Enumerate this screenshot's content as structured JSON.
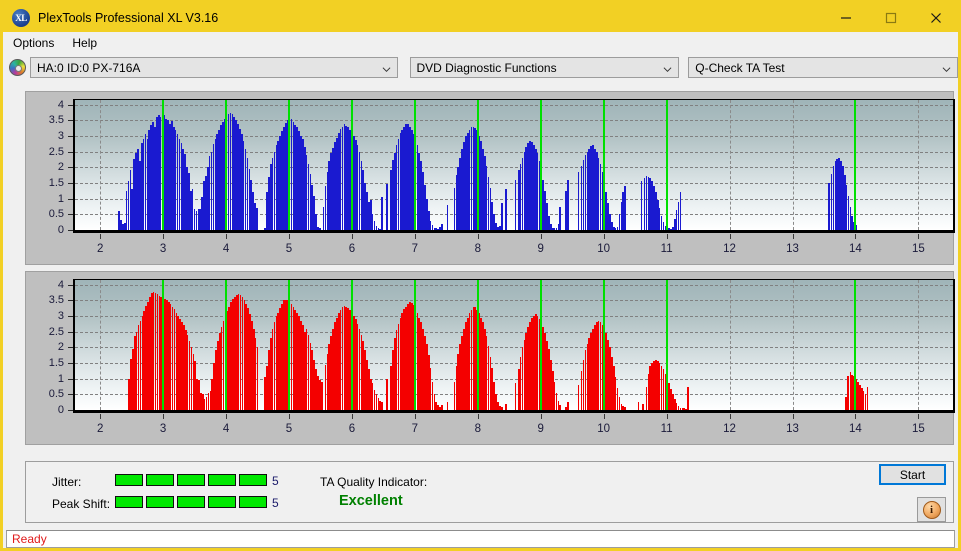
{
  "window": {
    "title": "PlexTools Professional XL V3.16",
    "app_icon": "xl-logo-icon",
    "minimize_label": "Minimize",
    "maximize_label": "Maximize",
    "close_label": "Close"
  },
  "menubar": {
    "items": [
      {
        "label": "Options"
      },
      {
        "label": "Help"
      }
    ]
  },
  "toolbar": {
    "drive_icon": "disc-icon",
    "drive_select": {
      "value": "HA:0 ID:0  PX-716A"
    },
    "function_select": {
      "value": "DVD Diagnostic Functions"
    },
    "test_select": {
      "value": "Q-Check TA Test"
    }
  },
  "results": {
    "jitter_label": "Jitter:",
    "jitter_value": "5",
    "jitter_segments": 5,
    "peak_shift_label": "Peak Shift:",
    "peak_shift_value": "5",
    "peak_shift_segments": 5,
    "ta_quality_label": "TA Quality Indicator:",
    "ta_quality_value": "Excellent",
    "ta_quality_color": "#008000",
    "start_label": "Start",
    "info_icon": "info-icon"
  },
  "statusbar": {
    "text": "Ready"
  },
  "colors": {
    "titlebar": "#f2d024",
    "window_border": "#f2d024",
    "blue_series": "#1a1ad0",
    "red_series": "#f40000",
    "marker_line": "#00e000",
    "status_text": "#e01b1b"
  },
  "chart_data": [
    {
      "type": "bar",
      "name": "jitter-chart",
      "series_color": "#1a1ad0",
      "title": "",
      "xlabel": "",
      "ylabel": "",
      "xlim": [
        1.6,
        15.55
      ],
      "ylim": [
        0,
        4.15
      ],
      "grid": true,
      "legend": "none",
      "yticks": [
        0,
        0.5,
        1,
        1.5,
        2,
        2.5,
        3,
        3.5,
        4
      ],
      "ytick_labels": [
        "0",
        "0.5",
        "1",
        "1.5",
        "2",
        "2.5",
        "3",
        "3.5",
        "4"
      ],
      "xticks": [
        2,
        3,
        4,
        5,
        6,
        7,
        8,
        9,
        10,
        11,
        12,
        13,
        14,
        15
      ],
      "xtick_labels": [
        "2",
        "3",
        "4",
        "5",
        "6",
        "7",
        "8",
        "9",
        "10",
        "11",
        "12",
        "13",
        "14",
        "15"
      ],
      "marker_lines": [
        3,
        4,
        5,
        6,
        7,
        8,
        9,
        10,
        11,
        14
      ],
      "bar_width": 0.022,
      "x": [
        2.3,
        2.33,
        2.36,
        2.39,
        2.42,
        2.45,
        2.48,
        2.51,
        2.54,
        2.57,
        2.6,
        2.63,
        2.66,
        2.69,
        2.72,
        2.75,
        2.78,
        2.81,
        2.84,
        2.87,
        2.9,
        2.93,
        2.96,
        2.99,
        3.02,
        3.05,
        3.08,
        3.11,
        3.14,
        3.17,
        3.2,
        3.23,
        3.26,
        3.29,
        3.32,
        3.35,
        3.38,
        3.41,
        3.44,
        3.47,
        3.5,
        3.53,
        3.56,
        3.59,
        3.62,
        3.65,
        3.68,
        3.71,
        3.74,
        3.77,
        3.8,
        3.83,
        3.86,
        3.89,
        3.92,
        3.95,
        3.98,
        4.01,
        4.04,
        4.07,
        4.1,
        4.13,
        4.16,
        4.19,
        4.22,
        4.25,
        4.28,
        4.31,
        4.34,
        4.37,
        4.4,
        4.43,
        4.46,
        4.49,
        4.62,
        4.65,
        4.68,
        4.71,
        4.74,
        4.77,
        4.8,
        4.83,
        4.86,
        4.89,
        4.92,
        4.95,
        4.98,
        5.01,
        5.04,
        5.07,
        5.1,
        5.13,
        5.16,
        5.19,
        5.22,
        5.25,
        5.28,
        5.31,
        5.34,
        5.37,
        5.4,
        5.43,
        5.46,
        5.49,
        5.55,
        5.58,
        5.61,
        5.64,
        5.67,
        5.7,
        5.73,
        5.76,
        5.79,
        5.82,
        5.85,
        5.88,
        5.91,
        5.94,
        5.97,
        6.0,
        6.03,
        6.06,
        6.09,
        6.12,
        6.15,
        6.18,
        6.21,
        6.24,
        6.27,
        6.3,
        6.33,
        6.36,
        6.39,
        6.42,
        6.45,
        6.48,
        6.56,
        6.62,
        6.65,
        6.68,
        6.71,
        6.74,
        6.77,
        6.8,
        6.83,
        6.86,
        6.89,
        6.92,
        6.95,
        6.98,
        7.01,
        7.04,
        7.07,
        7.1,
        7.13,
        7.16,
        7.19,
        7.22,
        7.25,
        7.28,
        7.31,
        7.34,
        7.37,
        7.4,
        7.43,
        7.52,
        7.63,
        7.66,
        7.69,
        7.72,
        7.75,
        7.78,
        7.81,
        7.84,
        7.87,
        7.9,
        7.93,
        7.96,
        7.99,
        8.02,
        8.05,
        8.08,
        8.11,
        8.14,
        8.17,
        8.2,
        8.23,
        8.26,
        8.29,
        8.32,
        8.35,
        8.38,
        8.45,
        8.6,
        8.65,
        8.68,
        8.71,
        8.74,
        8.77,
        8.8,
        8.83,
        8.86,
        8.89,
        8.92,
        8.95,
        8.98,
        9.01,
        9.04,
        9.07,
        9.1,
        9.13,
        9.16,
        9.19,
        9.22,
        9.25,
        9.28,
        9.31,
        9.4,
        9.43,
        9.6,
        9.65,
        9.68,
        9.71,
        9.74,
        9.77,
        9.8,
        9.83,
        9.86,
        9.89,
        9.92,
        9.95,
        9.98,
        10.01,
        10.04,
        10.07,
        10.1,
        10.13,
        10.16,
        10.19,
        10.22,
        10.25,
        10.28,
        10.31,
        10.34,
        10.6,
        10.65,
        10.68,
        10.71,
        10.74,
        10.77,
        10.8,
        10.83,
        10.86,
        10.89,
        10.92,
        10.95,
        10.98,
        11.01,
        11.04,
        11.07,
        11.1,
        11.13,
        11.16,
        11.19,
        11.22,
        13.58,
        13.62,
        13.65,
        13.68,
        13.71,
        13.74,
        13.77,
        13.8,
        13.83,
        13.86,
        13.89,
        13.92,
        13.95,
        13.98,
        14.01,
        14.04,
        14.07,
        14.1,
        14.13,
        14.2
      ],
      "values": [
        0.62,
        0.32,
        0.18,
        0.22,
        1.26,
        1.55,
        1.9,
        1.3,
        2.26,
        2.45,
        2.6,
        2.2,
        2.78,
        2.92,
        3.05,
        2.9,
        3.18,
        3.35,
        3.45,
        3.3,
        3.6,
        3.68,
        3.62,
        3.7,
        3.66,
        3.55,
        3.5,
        3.4,
        3.48,
        3.3,
        3.2,
        3.05,
        2.9,
        2.78,
        2.6,
        2.42,
        2.0,
        1.82,
        1.25,
        1.3,
        0.66,
        0.62,
        0.68,
        0.66,
        1.05,
        1.55,
        1.72,
        2.0,
        2.35,
        2.5,
        2.75,
        2.9,
        3.05,
        3.2,
        3.35,
        3.45,
        3.55,
        3.62,
        3.7,
        3.74,
        3.7,
        3.6,
        3.5,
        3.38,
        3.22,
        3.05,
        2.85,
        2.6,
        2.3,
        1.95,
        1.6,
        1.2,
        0.85,
        0.7,
        0.05,
        1.2,
        1.68,
        2.1,
        2.3,
        2.5,
        2.7,
        2.85,
        3.0,
        3.15,
        3.3,
        3.42,
        3.5,
        3.58,
        3.55,
        3.45,
        3.35,
        3.3,
        3.15,
        3.0,
        2.9,
        2.65,
        2.4,
        2.1,
        1.8,
        1.45,
        1.1,
        0.5,
        0.1,
        0.05,
        0.75,
        1.4,
        1.85,
        2.2,
        2.45,
        2.62,
        2.8,
        2.95,
        3.1,
        3.22,
        3.3,
        3.38,
        3.32,
        3.3,
        3.2,
        3.05,
        3.0,
        2.88,
        2.7,
        2.5,
        2.2,
        1.9,
        1.5,
        1.2,
        0.9,
        0.95,
        0.5,
        0.3,
        0.12,
        0.05,
        0.04,
        1.05,
        1.48,
        1.9,
        2.25,
        2.45,
        2.7,
        2.9,
        3.1,
        3.2,
        3.3,
        3.4,
        3.38,
        3.3,
        3.2,
        3.05,
        2.9,
        2.7,
        2.45,
        2.2,
        1.85,
        1.45,
        1.0,
        0.6,
        0.3,
        0.15,
        0.08,
        0.05,
        0.04,
        0.1,
        0.2,
        0.8,
        1.35,
        1.75,
        2.0,
        2.3,
        2.6,
        2.8,
        3.0,
        3.1,
        3.2,
        3.28,
        3.3,
        3.25,
        3.18,
        3.0,
        2.85,
        2.6,
        2.35,
        2.05,
        1.7,
        1.35,
        0.9,
        0.5,
        0.22,
        0.1,
        0.12,
        0.85,
        1.3,
        1.6,
        1.9,
        2.1,
        2.3,
        2.5,
        2.65,
        2.78,
        2.85,
        2.8,
        2.72,
        2.6,
        2.45,
        2.2,
        1.95,
        1.6,
        1.25,
        0.85,
        0.45,
        0.2,
        0.07,
        0.06,
        0.08,
        0.2,
        0.75,
        1.25,
        1.6,
        1.85,
        2.05,
        2.25,
        2.4,
        2.5,
        2.6,
        2.68,
        2.7,
        2.6,
        2.5,
        2.3,
        2.1,
        1.85,
        1.55,
        1.2,
        0.85,
        0.5,
        0.25,
        0.1,
        0.08,
        0.1,
        0.5,
        0.9,
        1.2,
        1.4,
        1.55,
        1.65,
        1.72,
        1.7,
        1.65,
        1.55,
        1.4,
        1.2,
        0.95,
        0.7,
        0.45,
        0.25,
        0.12,
        0.06,
        0.05,
        0.04,
        0.1,
        0.35,
        0.65,
        0.9,
        1.2,
        1.5,
        1.8,
        2.05,
        2.2,
        2.28,
        2.3,
        2.2,
        2.05,
        1.75,
        1.45,
        1.1,
        0.75,
        0.45,
        0.25,
        0.15
      ]
    },
    {
      "type": "bar",
      "name": "peak-shift-chart",
      "series_color": "#f40000",
      "title": "",
      "xlabel": "",
      "ylabel": "",
      "xlim": [
        1.6,
        15.55
      ],
      "ylim": [
        0,
        4.15
      ],
      "grid": true,
      "legend": "none",
      "yticks": [
        0,
        0.5,
        1,
        1.5,
        2,
        2.5,
        3,
        3.5,
        4
      ],
      "ytick_labels": [
        "0",
        "0.5",
        "1",
        "1.5",
        "2",
        "2.5",
        "3",
        "3.5",
        "4"
      ],
      "xticks": [
        2,
        3,
        4,
        5,
        6,
        7,
        8,
        9,
        10,
        11,
        12,
        13,
        14,
        15
      ],
      "xtick_labels": [
        "2",
        "3",
        "4",
        "5",
        "6",
        "7",
        "8",
        "9",
        "10",
        "11",
        "12",
        "13",
        "14",
        "15"
      ],
      "marker_lines": [
        3,
        4,
        5,
        6,
        7,
        8,
        9,
        10,
        11,
        14
      ],
      "bar_width": 0.022,
      "x": [
        2.46,
        2.49,
        2.52,
        2.55,
        2.58,
        2.61,
        2.64,
        2.67,
        2.7,
        2.73,
        2.76,
        2.79,
        2.82,
        2.85,
        2.88,
        2.91,
        2.94,
        2.97,
        3.0,
        3.03,
        3.06,
        3.09,
        3.12,
        3.15,
        3.18,
        3.21,
        3.24,
        3.27,
        3.3,
        3.33,
        3.36,
        3.39,
        3.42,
        3.45,
        3.48,
        3.51,
        3.54,
        3.57,
        3.6,
        3.63,
        3.66,
        3.69,
        3.72,
        3.75,
        3.78,
        3.81,
        3.84,
        3.87,
        3.9,
        3.93,
        3.96,
        3.99,
        4.02,
        4.05,
        4.08,
        4.11,
        4.14,
        4.17,
        4.2,
        4.23,
        4.26,
        4.29,
        4.32,
        4.35,
        4.38,
        4.41,
        4.44,
        4.47,
        4.5,
        4.62,
        4.65,
        4.68,
        4.71,
        4.74,
        4.77,
        4.8,
        4.83,
        4.86,
        4.89,
        4.92,
        4.95,
        4.98,
        5.01,
        5.04,
        5.07,
        5.1,
        5.13,
        5.16,
        5.19,
        5.22,
        5.25,
        5.28,
        5.31,
        5.34,
        5.37,
        5.4,
        5.43,
        5.46,
        5.49,
        5.52,
        5.58,
        5.61,
        5.64,
        5.67,
        5.7,
        5.73,
        5.76,
        5.79,
        5.82,
        5.85,
        5.88,
        5.91,
        5.94,
        5.97,
        6.0,
        6.03,
        6.06,
        6.09,
        6.12,
        6.15,
        6.18,
        6.21,
        6.24,
        6.27,
        6.3,
        6.33,
        6.36,
        6.39,
        6.42,
        6.45,
        6.48,
        6.56,
        6.62,
        6.65,
        6.68,
        6.71,
        6.74,
        6.77,
        6.8,
        6.83,
        6.86,
        6.89,
        6.92,
        6.95,
        6.98,
        7.01,
        7.04,
        7.07,
        7.1,
        7.13,
        7.16,
        7.19,
        7.22,
        7.25,
        7.28,
        7.31,
        7.34,
        7.37,
        7.4,
        7.43,
        7.52,
        7.63,
        7.66,
        7.69,
        7.72,
        7.75,
        7.78,
        7.81,
        7.84,
        7.87,
        7.9,
        7.93,
        7.96,
        7.99,
        8.02,
        8.05,
        8.08,
        8.11,
        8.14,
        8.17,
        8.2,
        8.23,
        8.26,
        8.29,
        8.32,
        8.35,
        8.38,
        8.45,
        8.6,
        8.65,
        8.68,
        8.71,
        8.74,
        8.77,
        8.8,
        8.83,
        8.86,
        8.89,
        8.92,
        8.95,
        8.98,
        9.01,
        9.04,
        9.07,
        9.1,
        9.13,
        9.16,
        9.19,
        9.22,
        9.25,
        9.28,
        9.31,
        9.4,
        9.43,
        9.6,
        9.65,
        9.68,
        9.71,
        9.74,
        9.77,
        9.8,
        9.83,
        9.86,
        9.89,
        9.92,
        9.95,
        9.98,
        10.01,
        10.04,
        10.07,
        10.1,
        10.13,
        10.16,
        10.19,
        10.22,
        10.25,
        10.28,
        10.31,
        10.34,
        10.55,
        10.62,
        10.68,
        10.71,
        10.74,
        10.77,
        10.8,
        10.83,
        10.86,
        10.89,
        10.92,
        10.95,
        10.98,
        11.01,
        11.04,
        11.07,
        11.1,
        11.13,
        11.16,
        11.19,
        11.22,
        11.25,
        11.28,
        11.31,
        11.34,
        13.85,
        13.88,
        13.92,
        13.95,
        13.98,
        14.01,
        14.04,
        14.07,
        14.1,
        14.13,
        14.16,
        14.19,
        14.22
      ],
      "values": [
        1.0,
        1.62,
        1.95,
        2.35,
        2.5,
        2.72,
        2.85,
        3.0,
        3.15,
        3.32,
        3.45,
        3.6,
        3.72,
        3.78,
        3.74,
        3.7,
        3.65,
        3.62,
        3.68,
        3.55,
        3.5,
        3.44,
        3.4,
        3.3,
        3.22,
        3.1,
        3.0,
        2.9,
        2.8,
        2.7,
        2.55,
        2.4,
        2.2,
        2.0,
        1.8,
        1.55,
        1.0,
        0.95,
        0.55,
        0.5,
        0.35,
        0.4,
        0.55,
        0.6,
        1.0,
        1.5,
        1.9,
        2.2,
        2.45,
        2.65,
        2.85,
        3.0,
        3.15,
        3.3,
        3.45,
        3.55,
        3.6,
        3.68,
        3.7,
        3.68,
        3.6,
        3.5,
        3.38,
        3.25,
        3.05,
        2.85,
        2.6,
        2.3,
        2.0,
        1.05,
        1.4,
        1.92,
        2.3,
        2.6,
        2.82,
        3.0,
        3.1,
        3.25,
        3.4,
        3.5,
        3.52,
        3.5,
        3.45,
        3.4,
        3.3,
        3.2,
        3.1,
        3.0,
        2.85,
        2.7,
        2.5,
        2.6,
        2.4,
        2.15,
        1.9,
        1.6,
        1.3,
        1.1,
        0.95,
        0.9,
        1.45,
        1.8,
        2.1,
        2.35,
        2.6,
        2.8,
        2.95,
        3.1,
        3.2,
        3.3,
        3.32,
        3.28,
        3.25,
        3.18,
        3.1,
        3.0,
        2.9,
        2.75,
        2.6,
        2.4,
        2.2,
        1.9,
        1.6,
        1.3,
        1.0,
        0.85,
        0.65,
        0.5,
        0.38,
        0.3,
        0.25,
        1.0,
        1.4,
        1.9,
        2.3,
        2.55,
        2.75,
        2.95,
        3.1,
        3.22,
        3.3,
        3.4,
        3.45,
        3.42,
        3.35,
        3.25,
        3.1,
        2.95,
        2.8,
        2.6,
        2.35,
        2.1,
        1.75,
        1.35,
        0.9,
        0.5,
        0.25,
        0.15,
        0.1,
        0.15,
        0.25,
        0.9,
        1.4,
        1.8,
        2.1,
        2.35,
        2.6,
        2.8,
        2.95,
        3.1,
        3.2,
        3.3,
        3.28,
        3.2,
        3.1,
        2.95,
        2.8,
        2.6,
        2.35,
        2.05,
        1.7,
        1.35,
        0.9,
        0.5,
        0.25,
        0.12,
        0.1,
        0.2,
        0.85,
        1.3,
        1.7,
        2.0,
        2.25,
        2.45,
        2.65,
        2.8,
        2.95,
        3.0,
        3.05,
        3.0,
        2.9,
        2.8,
        2.65,
        2.45,
        2.2,
        1.95,
        1.6,
        1.25,
        0.9,
        0.55,
        0.3,
        0.15,
        0.1,
        0.25,
        0.8,
        1.25,
        1.6,
        1.9,
        2.1,
        2.3,
        2.45,
        2.6,
        2.7,
        2.8,
        2.85,
        2.8,
        2.7,
        2.6,
        2.45,
        2.25,
        2.0,
        1.7,
        1.4,
        1.05,
        0.7,
        0.4,
        0.2,
        0.12,
        0.1,
        0.25,
        0.2,
        0.75,
        1.15,
        1.4,
        1.5,
        1.58,
        1.6,
        1.58,
        1.5,
        1.4,
        1.3,
        1.15,
        1.0,
        0.85,
        0.68,
        0.5,
        0.35,
        0.22,
        0.12,
        0.08,
        0.06,
        0.05,
        0.04,
        0.75,
        0.4,
        1.1,
        1.2,
        1.12,
        1.08,
        1.0,
        0.9,
        0.8,
        0.7,
        0.6,
        0.5,
        0.75
      ]
    }
  ]
}
